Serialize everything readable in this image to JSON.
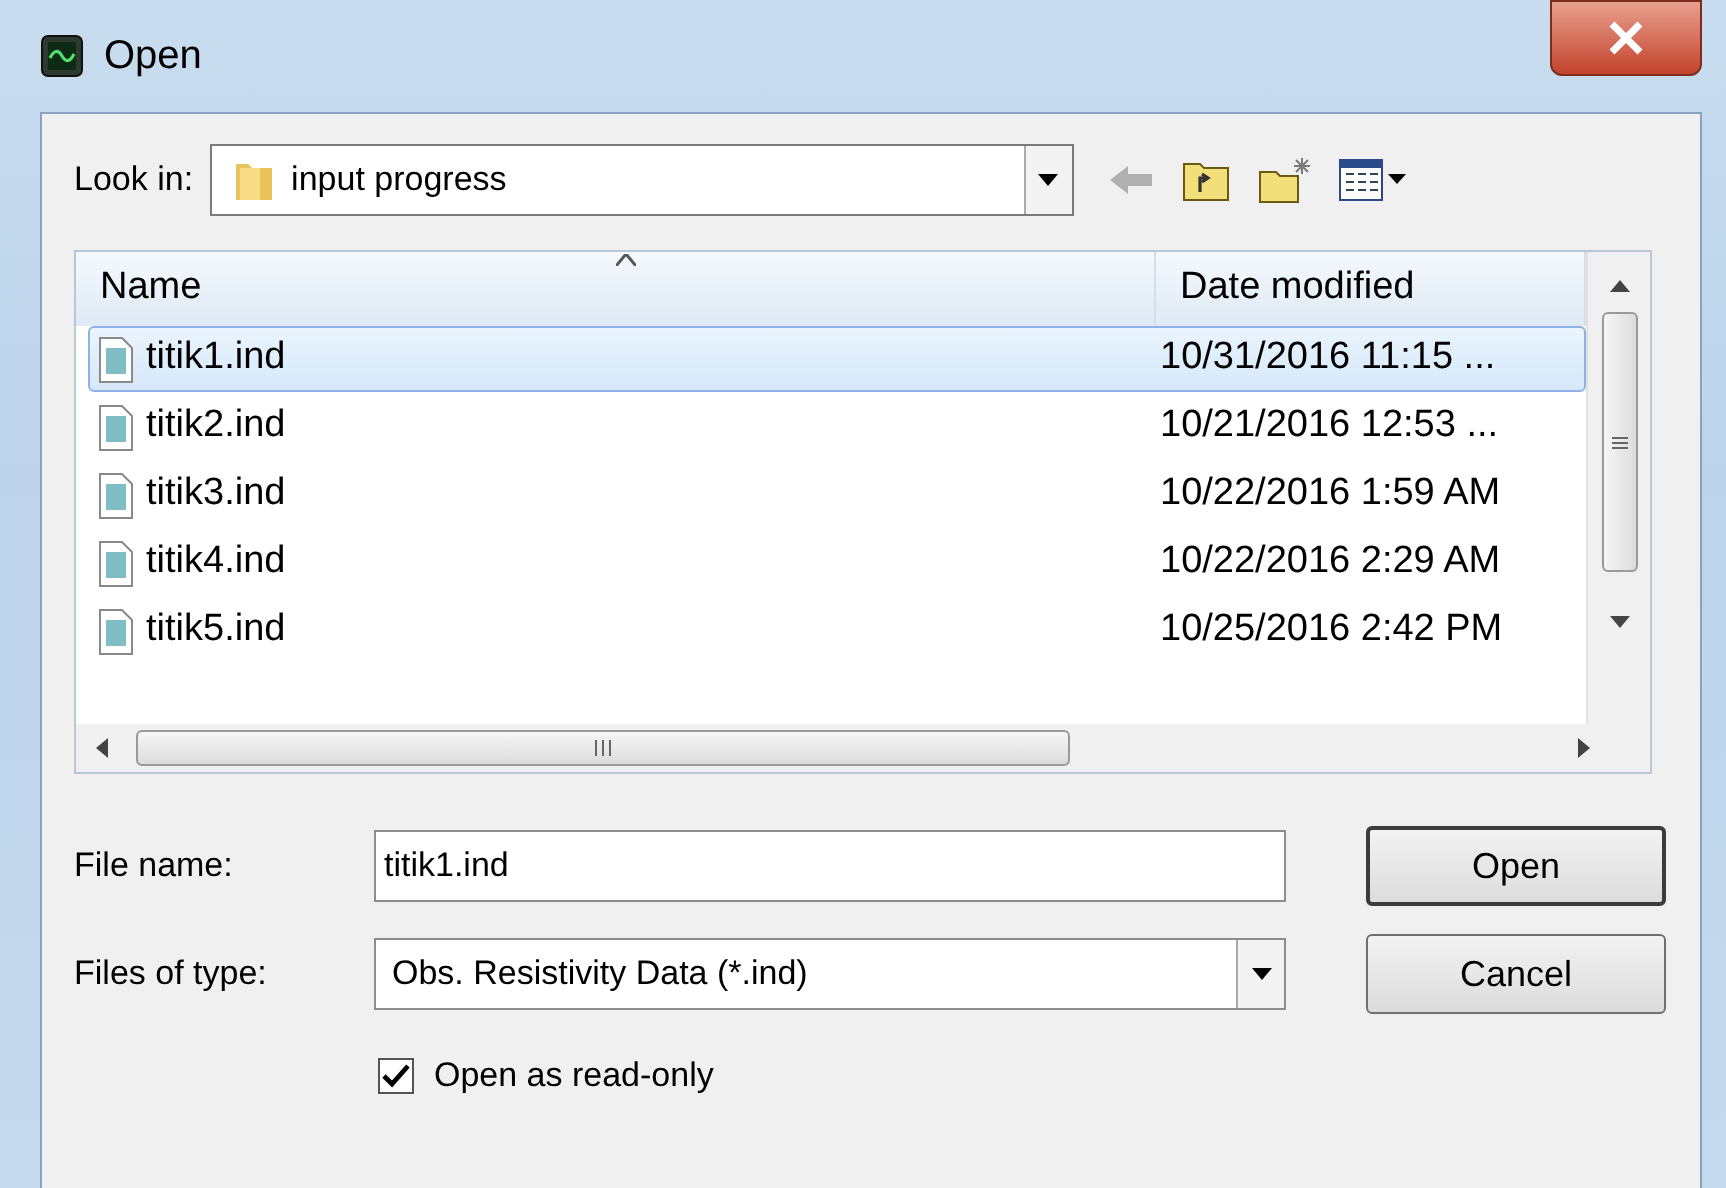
{
  "window": {
    "title": "Open"
  },
  "look_in": {
    "label": "Look in:",
    "value": "input progress"
  },
  "columns": [
    {
      "label": "Name",
      "sorted": true
    },
    {
      "label": "Date modified",
      "sorted": false
    }
  ],
  "files": [
    {
      "name": "titik1.ind",
      "date": "10/31/2016 11:15 ...",
      "selected": true
    },
    {
      "name": "titik2.ind",
      "date": "10/21/2016 12:53 ...",
      "selected": false
    },
    {
      "name": "titik3.ind",
      "date": "10/22/2016 1:59 AM",
      "selected": false
    },
    {
      "name": "titik4.ind",
      "date": "10/22/2016 2:29 AM",
      "selected": false
    },
    {
      "name": "titik5.ind",
      "date": "10/25/2016 2:42 PM",
      "selected": false
    }
  ],
  "file_name": {
    "label": "File name:",
    "value": "titik1.ind"
  },
  "file_type": {
    "label": "Files of type:",
    "value": "Obs. Resistivity Data (*.ind)"
  },
  "buttons": [
    {
      "label": "Open",
      "default": true
    },
    {
      "label": "Cancel",
      "default": false
    }
  ],
  "read_only": {
    "label": "Open as read-only",
    "checked": true
  }
}
